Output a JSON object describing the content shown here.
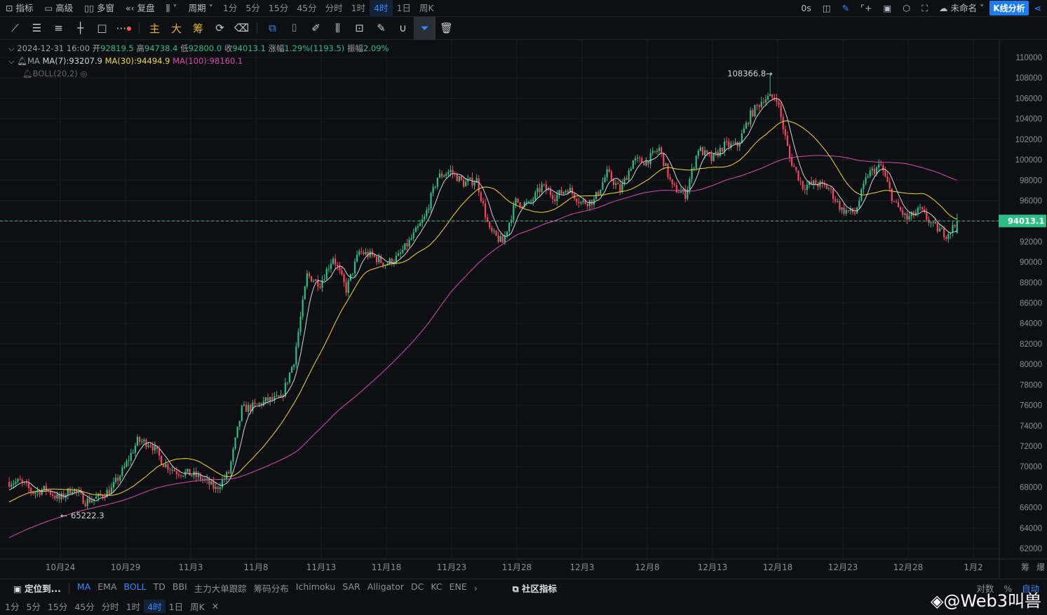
{
  "topbar": {
    "items": [
      "指标",
      "高级",
      "多窗",
      "复盘"
    ],
    "period_label": "周期",
    "periods": [
      "1分",
      "5分",
      "15分",
      "45分",
      "分时",
      "1时",
      "4时",
      "1日",
      "周K"
    ],
    "active_period": "4时",
    "timer": "0s",
    "layout_name": "未命名",
    "analysis_button": "K线分析"
  },
  "toolbar": {
    "text_tools": [
      "主",
      "大",
      "筹"
    ]
  },
  "legend": {
    "datetime": "2024-12-31 16:00",
    "open_label": "开",
    "open": "92819.5",
    "high_label": "高",
    "high": "94738.4",
    "low_label": "低",
    "low": "92800.0",
    "close_label": "收",
    "close": "94013.1",
    "change_label": "涨幅",
    "change": "1.29%(1193.5)",
    "amp_label": "振幅",
    "amp": "2.09%",
    "ma_label": "MA",
    "ma7": "MA(7):93207.9",
    "ma30": "MA(30):94494.9",
    "ma100": "MA(100):98160.1",
    "boll": "BOLL(20,2)"
  },
  "colors": {
    "up": "#2ebd85",
    "down": "#f6465d",
    "ma7": "#d0d3d8",
    "ma30": "#f0d932",
    "ma100": "#d84bb0",
    "accent": "#2f8cff"
  },
  "chart_data": {
    "type": "candlestick",
    "interval": "4h",
    "ylim": [
      61000,
      111000
    ],
    "yticks": [
      62000,
      64000,
      66000,
      68000,
      70000,
      72000,
      74000,
      76000,
      78000,
      80000,
      82000,
      84000,
      86000,
      88000,
      90000,
      92000,
      94000,
      96000,
      98000,
      100000,
      102000,
      104000,
      106000,
      108000,
      110000
    ],
    "xticks": [
      {
        "label": "10月24",
        "day": 4
      },
      {
        "label": "10月29",
        "day": 9
      },
      {
        "label": "11月3",
        "day": 14
      },
      {
        "label": "11月8",
        "day": 19
      },
      {
        "label": "11月13",
        "day": 24
      },
      {
        "label": "11月18",
        "day": 29
      },
      {
        "label": "11月23",
        "day": 34
      },
      {
        "label": "11月28",
        "day": 39
      },
      {
        "label": "12月3",
        "day": 44
      },
      {
        "label": "12月8",
        "day": 49
      },
      {
        "label": "12月13",
        "day": 54
      },
      {
        "label": "12月18",
        "day": 59
      },
      {
        "label": "12月23",
        "day": 64
      },
      {
        "label": "12月28",
        "day": 69
      },
      {
        "label": "1月2",
        "day": 74
      }
    ],
    "start_date": "10月20",
    "daily_close": [
      68500,
      67500,
      67800,
      66800,
      67900,
      66600,
      67000,
      67800,
      69900,
      72500,
      72300,
      70300,
      69500,
      69300,
      68800,
      67800,
      69400,
      75600,
      75900,
      76500,
      76600,
      80400,
      88700,
      87900,
      90500,
      87300,
      91000,
      90600,
      89800,
      90500,
      92300,
      94300,
      98300,
      98900,
      97700,
      98000,
      93000,
      91900,
      95900,
      95600,
      97400,
      96400,
      97200,
      95800,
      96000,
      98700,
      97000,
      99900,
      99800,
      101100,
      97300,
      96600,
      101100,
      100000,
      101400,
      101400,
      104400,
      106000,
      106100,
      100200,
      97400,
      97700,
      97200,
      95100,
      94800,
      98600,
      99400,
      95800,
      94200,
      95100,
      93500,
      92700,
      94013.1
    ],
    "last_price": "94013.1",
    "max_label": "108366.8",
    "min_label": "65222.3"
  },
  "bottom": {
    "locate": "定位到...",
    "indicators": [
      "MA",
      "EMA",
      "BOLL",
      "TD",
      "BBI",
      "主力大单跟踪",
      "筹码分布",
      "Ichimoku",
      "SAR",
      "Alligator",
      "DC",
      "KC",
      "ENE"
    ],
    "active_indicators": [
      "MA",
      "BOLL"
    ],
    "community": "社区指标",
    "periods": [
      "1分",
      "5分",
      "15分",
      "45分",
      "分时",
      "1时",
      "4时",
      "1日",
      "周K"
    ],
    "active_period": "4时",
    "scale_opts": [
      "对数",
      "%",
      "自动"
    ],
    "right_axis": [
      "筹",
      "爆"
    ]
  },
  "watermark": "@Web3叫兽"
}
